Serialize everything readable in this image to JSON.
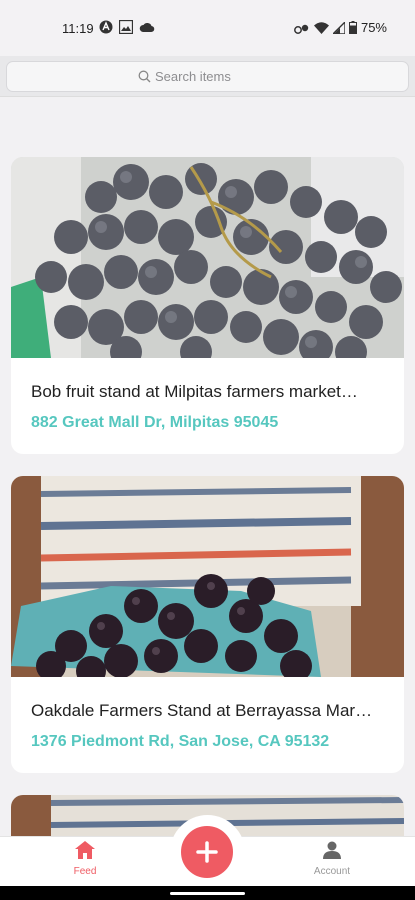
{
  "status": {
    "time": "11:19",
    "battery": "75%"
  },
  "search": {
    "placeholder": "Search items"
  },
  "cards": [
    {
      "title": "Bob fruit stand at Milpitas farmers market…",
      "address": "882 Great Mall Dr, Milpitas 95045",
      "image": "grapes-photo"
    },
    {
      "title": "Oakdale Farmers Stand at Berrayassa Mar…",
      "address": "1376 Piedmont Rd, San Jose, CA 95132",
      "image": "blackberries-photo"
    }
  ],
  "tabs": {
    "feed": "Feed",
    "account": "Account"
  },
  "colors": {
    "accent": "#ef5b63",
    "address": "#56c7bf"
  }
}
